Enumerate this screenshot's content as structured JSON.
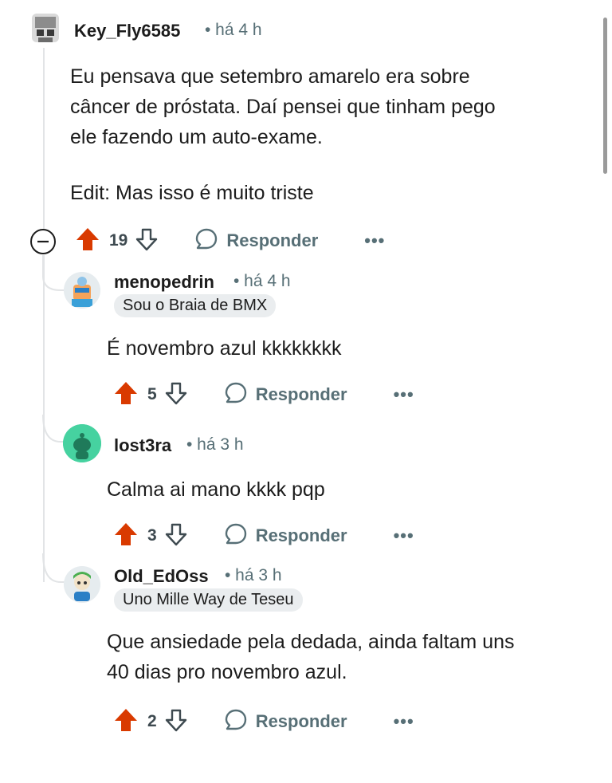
{
  "comments": [
    {
      "username": "Key_Fly6585",
      "time": "• há 4 h",
      "body": [
        "Eu pensava que setembro amarelo era sobre",
        "câncer de próstata. Daí pensei que tinham pego",
        "ele fazendo um auto-exame.",
        "",
        "Edit: Mas isso é muito triste"
      ],
      "votes": "19",
      "reply_label": "Responder",
      "more_label": "•••"
    },
    {
      "username": "menopedrin",
      "time": "• há 4 h",
      "flair": "Sou o Braia de BMX",
      "body": [
        "É novembro azul kkkkkkkk"
      ],
      "votes": "5",
      "reply_label": "Responder",
      "more_label": "•••"
    },
    {
      "username": "lost3ra",
      "time": "• há 3 h",
      "body": [
        "Calma ai mano kkkk pqp"
      ],
      "votes": "3",
      "reply_label": "Responder",
      "more_label": "•••"
    },
    {
      "username": "Old_EdOss",
      "time": "• há 3 h",
      "flair": "Uno Mille Way de Teseu",
      "body": [
        "Que ansiedade pela dedada, ainda faltam uns",
        "40 dias pro novembro azul."
      ],
      "votes": "2",
      "reply_label": "Responder",
      "more_label": "•••"
    }
  ],
  "colors": {
    "upvote_active": "#d93a00",
    "thread_line": "#e2e4e6",
    "meta_text": "#576f76",
    "flair_bg": "#eaedef",
    "lost3ra_avatar": "#46d2a0"
  },
  "icons": [
    "upvote-arrow-icon",
    "downvote-arrow-icon",
    "comment-bubble-icon",
    "collapse-minus-icon",
    "more-options-icon"
  ]
}
